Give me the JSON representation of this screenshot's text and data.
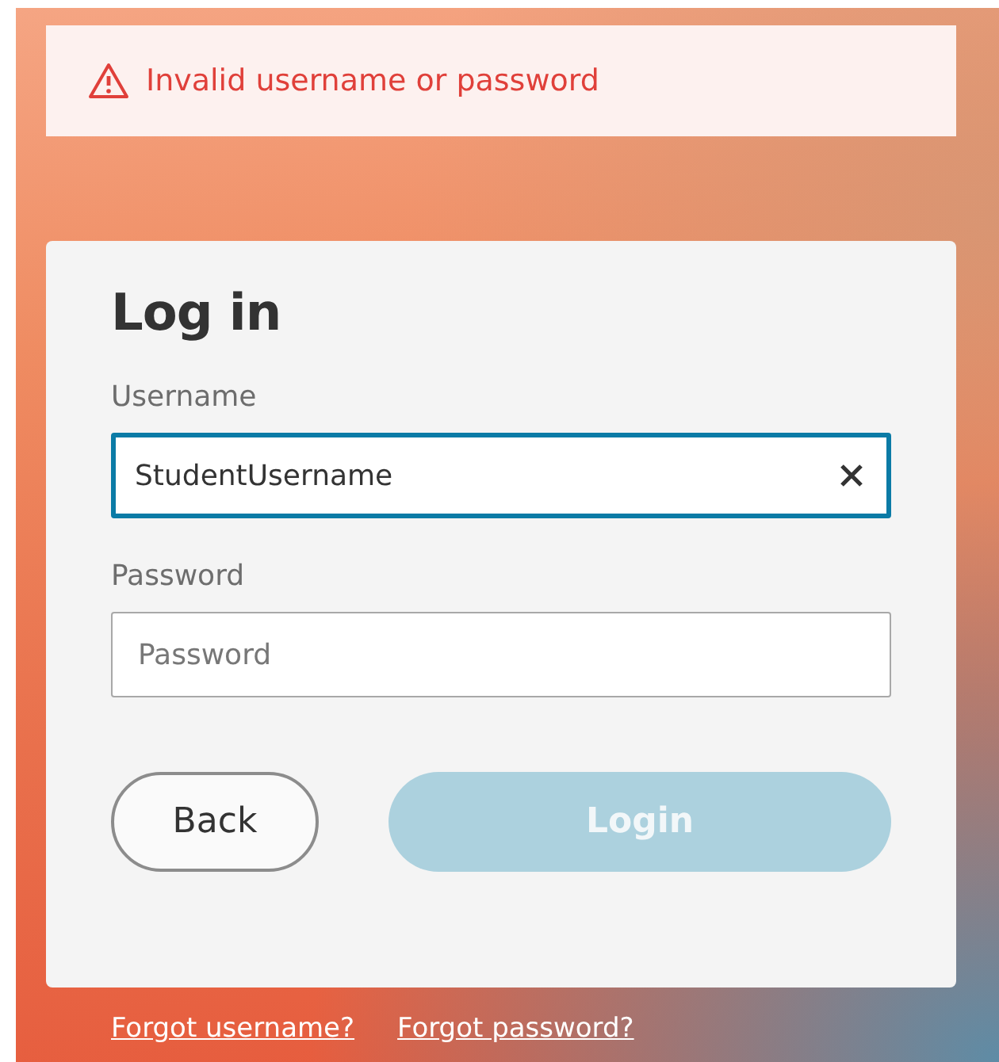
{
  "alert": {
    "message": "Invalid username or password"
  },
  "form": {
    "title": "Log in",
    "fields": [
      {
        "label": "Username",
        "value": "StudentUsername",
        "focused": true,
        "clearable": true
      },
      {
        "label": "Password",
        "placeholder": "Password",
        "focused": false
      }
    ],
    "buttons": [
      {
        "label": "Back",
        "kind": "secondary"
      },
      {
        "label": "Login",
        "kind": "primary",
        "disabled": true
      }
    ]
  },
  "links": [
    "Forgot username?",
    "Forgot password?"
  ]
}
